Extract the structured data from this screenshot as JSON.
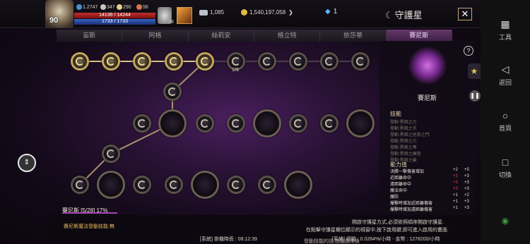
{
  "player": {
    "level": "90",
    "hp": "14136 / 14244",
    "mp": "1733 / 1733",
    "exp": "1.2747",
    "stat1": "347",
    "stat2": "290",
    "stat3": "56",
    "stat4": "38"
  },
  "currency": {
    "silver": "1,085",
    "gold": "1,540,197,058",
    "gem": "1"
  },
  "header": {
    "title": "守護星",
    "close": "✕"
  },
  "tabs": [
    "宙斯",
    "阿格",
    "絲莉安",
    "格立特",
    "依莎蒂",
    "賽尼斯"
  ],
  "panel": {
    "name": "賽尼斯",
    "skill_title": "技能",
    "skills": [
      "發動:黑暗之刃",
      "發動:黑暗之手",
      "發動:黑暗之拯救之門",
      "發動:黑暗之爪",
      "發動:黑暗之嗥",
      "發動:黑暗之擁抱",
      "發動:黑暗之巢"
    ],
    "ability_title": "能力值",
    "abilities": [
      [
        "決勝一擊傷害增加",
        "+2",
        "+5"
      ],
      [
        "近距離命中",
        "+3",
        "+3"
      ],
      [
        "遠距離命中",
        "+3",
        "+3"
      ],
      [
        "魔法命中",
        "+3",
        "+3"
      ],
      [
        "魔防",
        "+1",
        "+2"
      ],
      [
        "爆擊時增加近距離傷害",
        "+1",
        "+3"
      ],
      [
        "爆擊時增加遠距離傷害",
        "+1",
        "+3"
      ]
    ]
  },
  "progress": {
    "label": "賽尼斯 [5/28] 17%",
    "count": "1/9",
    "value": 0.17
  },
  "messages": {
    "a": "開啟守護星方式,必須依照順序開啟守護星.",
    "b": "在點擊守護星欄位顯示的視窗中,按下啟用鍵,即可進入啟用的畫面.",
    "c": "賽尼斯魔法發動技能:無",
    "d": "[系統] 掛機時長 : 08:12:39",
    "e": "[系統] 經驗 : 0.0264%/小時 - 金幣 : 1278200/小時",
    "f": "發動技能的話,技能啟用後"
  },
  "nav": {
    "tools": "工具",
    "back": "返回",
    "home": "首頁",
    "switch": "切換"
  }
}
